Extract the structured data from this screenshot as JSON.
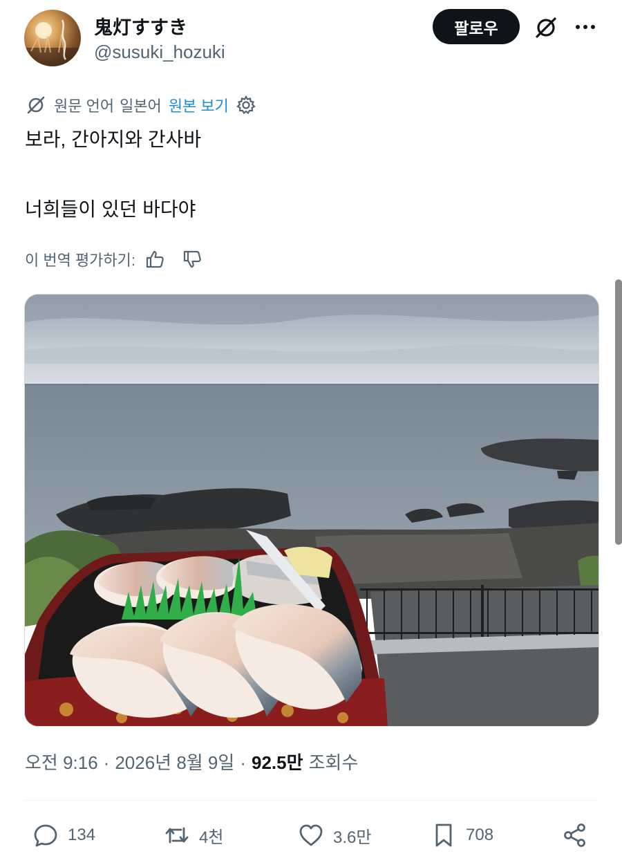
{
  "user": {
    "display_name": "鬼灯すすき",
    "handle": "@susuki_hozuki",
    "avatar_text": "鬼灯すすき"
  },
  "follow_label": "팔로우",
  "translation": {
    "prefix": "원문 언어",
    "language": "일본어",
    "show_original": "원본 보기"
  },
  "tweet": {
    "line1": "보라, 간아지와 간사바",
    "line2": "너희들이 있던 바다야"
  },
  "rating": {
    "label": "이 번역 평가하기:"
  },
  "meta": {
    "time": "오전 9:16",
    "date": "2026년 8월 9일",
    "views_count": "92.5만",
    "views_label": "조회수"
  },
  "actions": {
    "replies": "134",
    "reposts": "4천",
    "likes": "3.6만",
    "bookmarks": "708"
  },
  "colors": {
    "text": "#0f1419",
    "muted": "#536471",
    "link": "#1a8cd8",
    "button": "#0f1419"
  }
}
